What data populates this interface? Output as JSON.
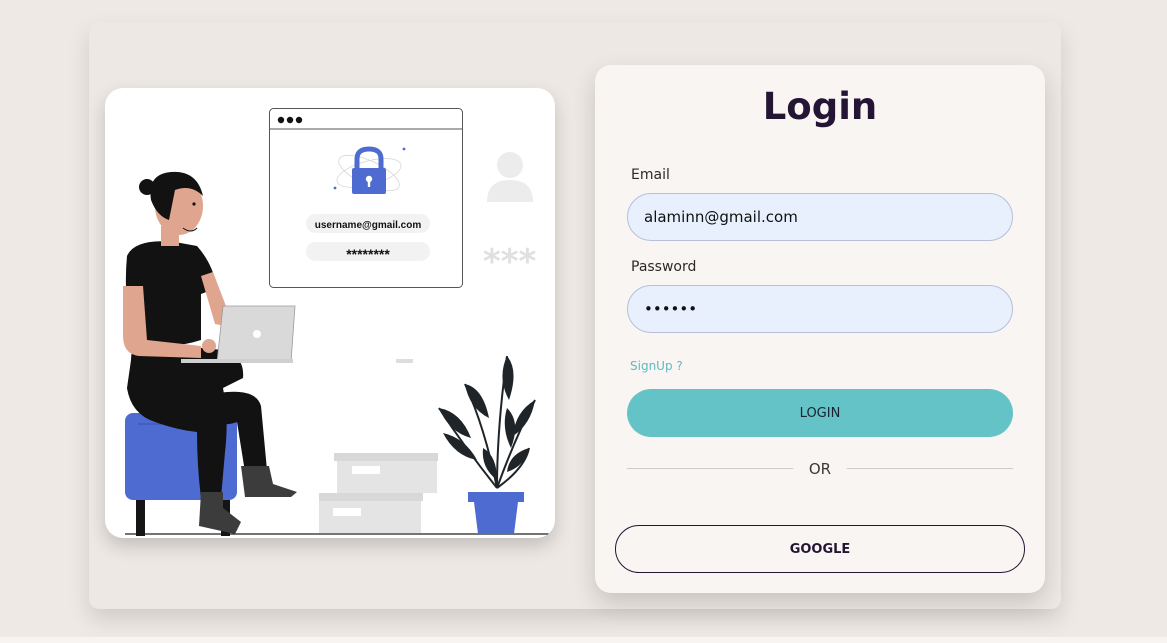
{
  "illustration": {
    "mock_email": "username@gmail.com",
    "mock_password": "********",
    "stars": "***"
  },
  "login": {
    "title": "Login",
    "email_label": "Email",
    "email_value": "alaminn@gmail.com",
    "password_label": "Password",
    "password_value": "••••••",
    "signup_link": "SignUp ?",
    "login_button": "LOGIN",
    "divider_text": "OR",
    "google_button": "GOOGLE"
  },
  "colors": {
    "background": "#efe9e5",
    "card": "#f9f5f3",
    "title": "#231533",
    "accent": "#64c3c6",
    "input_fill": "#e8f0fe",
    "illustration_blue": "#4d6bd1"
  }
}
